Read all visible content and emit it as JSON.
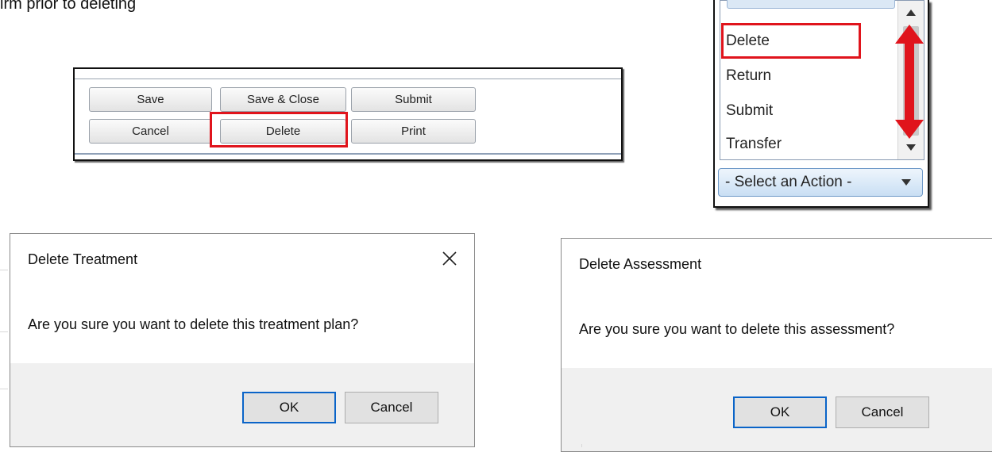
{
  "intro_text": "irm prior to deleting",
  "button_panel": {
    "row1": [
      "Save",
      "Save & Close",
      "Submit"
    ],
    "row2": [
      "Cancel",
      "Delete",
      "Print"
    ]
  },
  "action_dropdown": {
    "options": [
      "Delete",
      "Return",
      "Submit",
      "Transfer"
    ],
    "selected_label": "- Select an Action -"
  },
  "dialogs": [
    {
      "title": "Delete Treatment",
      "message": "Are you sure you want to delete this treatment plan?",
      "ok_label": "OK",
      "cancel_label": "Cancel"
    },
    {
      "title": "Delete Assessment",
      "message": "Are you sure you want to delete this assessment?",
      "ok_label": "OK",
      "cancel_label": "Cancel"
    }
  ],
  "colors": {
    "highlight_red": "#e0141c",
    "primary_button_border": "#0a64c8",
    "dialog_footer": "#f0f0f0"
  },
  "icons": [
    "close-icon",
    "scroll-up-icon",
    "scroll-down-icon",
    "dropdown-caret-icon",
    "double-arrow-icon"
  ]
}
